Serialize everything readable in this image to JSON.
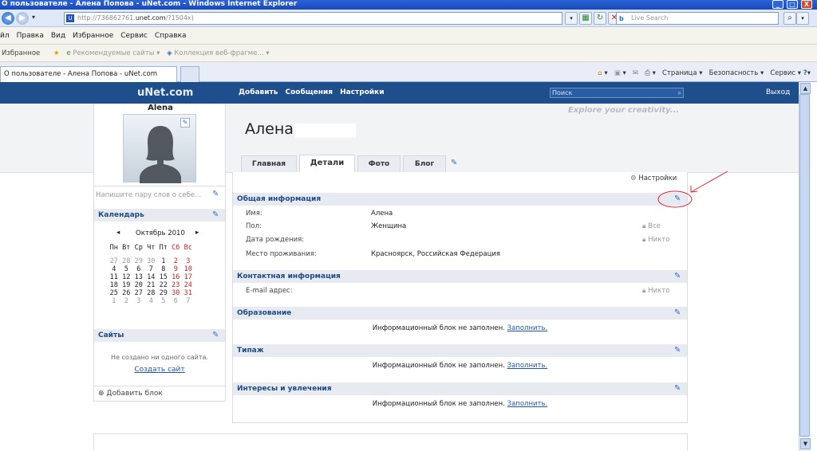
{
  "window": {
    "title": "О пользователе - Алена Попова - uNet.com - Windows Internet Explorer",
    "btn_min": "_",
    "btn_max": "□",
    "btn_close": "X"
  },
  "browser": {
    "address_prefix": "http://736862761.",
    "address_domain": "unet.com",
    "address_suffix": "/?1504x)",
    "search_placeholder": "Live Search",
    "menu": [
      "йл",
      "Правка",
      "Вид",
      "Избранное",
      "Сервис",
      "Справка"
    ],
    "fav_label": "Избранное",
    "fav_links": [
      "Рекомендуемые сайты ▾",
      "Коллекция веб-фрагме... ▾"
    ],
    "tab_title": "О пользователе - Алена Попова - uNet.com",
    "cmd": {
      "page": "Страница ▾",
      "security": "Безопасность ▾",
      "tools": "Сервис ▾"
    }
  },
  "site": {
    "brand": "uNet.com",
    "nav": [
      "Добавить",
      "Сообщения",
      "Настройки"
    ],
    "search_placeholder": "Поиск",
    "logout": "Выход",
    "tagline": "Explore your creativity..."
  },
  "sidebar": {
    "username": "Alena",
    "status_prompt": "Напишите пару слов о себе...",
    "calendar_title": "Календарь",
    "month": "Октябрь 2010",
    "prev": "◂",
    "next": "▸",
    "weekdays": [
      "Пн",
      "Вт",
      "Ср",
      "Чт",
      "Пт",
      "Сб",
      "Вс"
    ],
    "weeks": [
      [
        "27",
        "28",
        "29",
        "30",
        "1",
        "2",
        "3"
      ],
      [
        "4",
        "5",
        "6",
        "7",
        "8",
        "9",
        "10"
      ],
      [
        "11",
        "12",
        "13",
        "14",
        "15",
        "16",
        "17"
      ],
      [
        "18",
        "19",
        "20",
        "21",
        "22",
        "23",
        "24"
      ],
      [
        "25",
        "26",
        "27",
        "28",
        "29",
        "30",
        "31"
      ],
      [
        "1",
        "2",
        "3",
        "4",
        "5",
        "6",
        "7"
      ]
    ],
    "sites_title": "Сайты",
    "sites_empty": "Не создано ни одного сайта.",
    "create_site": "Создать сайт",
    "add_block": "Добавить блок"
  },
  "profile": {
    "name": "Алена",
    "tabs": [
      "Главная",
      "Детали",
      "Фото",
      "Блог"
    ],
    "settings": "Настройки",
    "general": {
      "title": "Общая информация",
      "rows": [
        {
          "label": "Имя:",
          "value": "Алена",
          "privacy": ""
        },
        {
          "label": "Пол:",
          "value": "Женщина",
          "privacy": "Все"
        },
        {
          "label": "Дата рождения:",
          "value": "",
          "privacy": "Никто"
        },
        {
          "label": "Место проживания:",
          "value": "Красноярск, Российская Федерация",
          "privacy": ""
        }
      ]
    },
    "contact": {
      "title": "Контактная информация",
      "rows": [
        {
          "label": "E-mail адрес:",
          "value": "",
          "privacy": "Никто"
        }
      ]
    },
    "empty_text": "Информационный блок не заполнен.",
    "fill_link": "Заполнить.",
    "sections": [
      "Образование",
      "Типаж",
      "Интересы и увлечения"
    ]
  }
}
